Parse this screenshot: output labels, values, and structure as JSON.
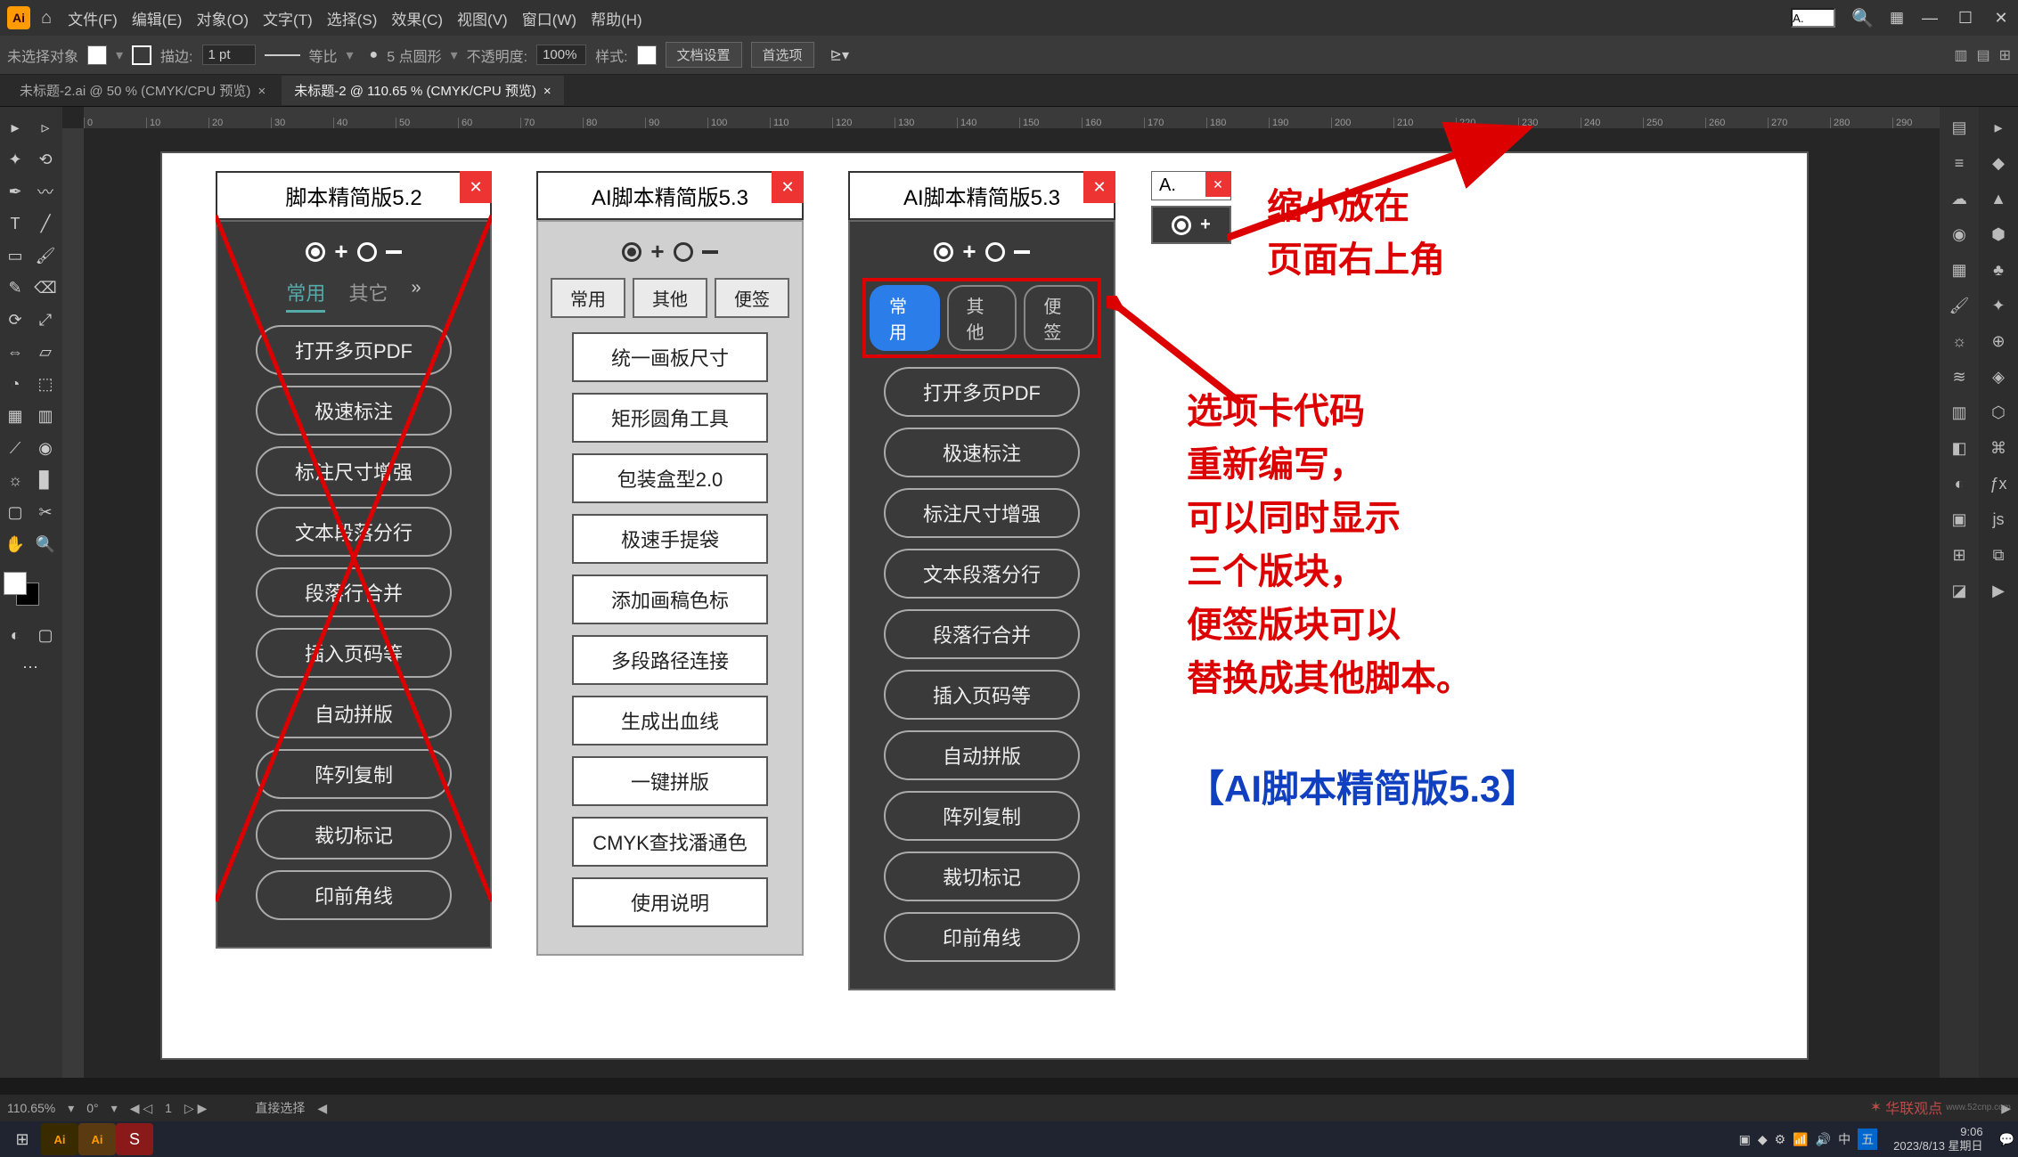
{
  "menubar": {
    "items": [
      "文件(F)",
      "编辑(E)",
      "对象(O)",
      "文字(T)",
      "选择(S)",
      "效果(C)",
      "视图(V)",
      "窗口(W)",
      "帮助(H)"
    ],
    "search_value": "A."
  },
  "controlbar": {
    "no_selection": "未选择对象",
    "stroke_label": "描边:",
    "stroke_val": "1 pt",
    "uniform": "等比",
    "points_label": "5 点圆形",
    "opacity_label": "不透明度:",
    "opacity_val": "100%",
    "style_label": "样式:",
    "doc_setup": "文档设置",
    "prefs": "首选项"
  },
  "tabs": {
    "t1": "未标题-2.ai @ 50 % (CMYK/CPU 预览)",
    "t2": "未标题-2 @ 110.65 % (CMYK/CPU 预览)"
  },
  "panel52": {
    "title": "脚本精简版5.2",
    "tabs": [
      "常用",
      "其它"
    ],
    "buttons": [
      "打开多页PDF",
      "极速标注",
      "标注尺寸增强",
      "文本段落分行",
      "段落行合并",
      "插入页码等",
      "自动拼版",
      "阵列复制",
      "裁切标记",
      "印前角线"
    ]
  },
  "panel53_light": {
    "title": "AI脚本精简版5.3",
    "tabs": [
      "常用",
      "其他",
      "便签"
    ],
    "buttons": [
      "统一画板尺寸",
      "矩形圆角工具",
      "包装盒型2.0",
      "极速手提袋",
      "添加画稿色标",
      "多段路径连接",
      "生成出血线",
      "一键拼版",
      "CMYK查找潘通色",
      "使用说明"
    ]
  },
  "panel53_dark": {
    "title": "AI脚本精简版5.3",
    "tabs": [
      "常用",
      "其他",
      "便签"
    ],
    "buttons": [
      "打开多页PDF",
      "极速标注",
      "标注尺寸增强",
      "文本段落分行",
      "段落行合并",
      "插入页码等",
      "自动拼版",
      "阵列复制",
      "裁切标记",
      "印前角线"
    ]
  },
  "mini_panel": {
    "title": "A."
  },
  "annotation1": "缩小放在\n页面右上角",
  "annotation2": "选项卡代码\n重新编写，\n可以同时显示\n三个版块，\n便签版块可以\n替换成其他脚本。",
  "annotation_title": "【AI脚本精简版5.3】",
  "statusbar": {
    "zoom": "110.65%",
    "rot": "0°",
    "artboard": "1",
    "tool": "直接选择"
  },
  "taskbar": {
    "time": "9:06",
    "date": "2023/8/13 星期日"
  },
  "watermark": "华联观点"
}
